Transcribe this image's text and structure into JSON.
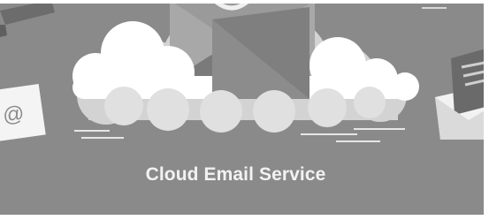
{
  "banner": {
    "title": "Cloud Email Service",
    "background_color": "#8a8a8a",
    "title_color": "#f2f2f2",
    "illustration": {
      "main_icon": "cloud-email-icon",
      "left_icon": "at-sign-envelope-icon",
      "right_icon": "open-envelope-icon",
      "top_left_icon": "pencil-icon",
      "at_symbol": "@"
    }
  }
}
